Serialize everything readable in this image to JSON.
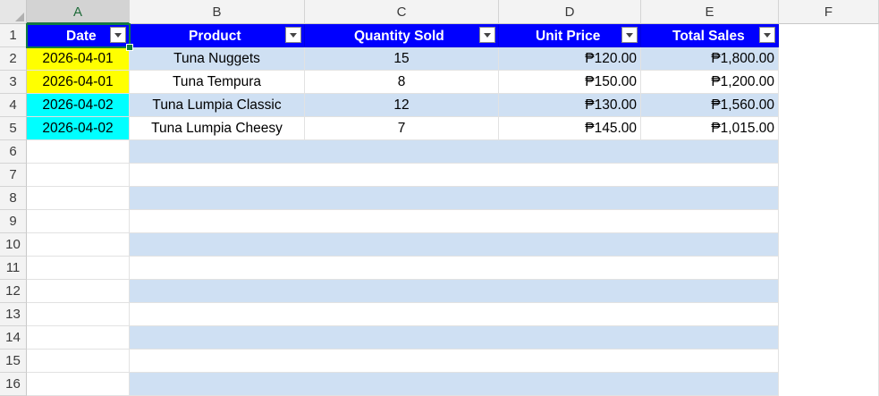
{
  "columns": [
    "A",
    "B",
    "C",
    "D",
    "E",
    "F"
  ],
  "rows": [
    "1",
    "2",
    "3",
    "4",
    "5",
    "6",
    "7",
    "8",
    "9",
    "10",
    "11",
    "12",
    "13",
    "14",
    "15",
    "16"
  ],
  "table": {
    "headers": [
      "Date",
      "Product",
      "Quantity Sold",
      "Unit Price",
      "Total Sales"
    ],
    "rows": [
      {
        "date": "2026-04-01",
        "product": "Tuna Nuggets",
        "qty": "15",
        "unit_price": "₱120.00",
        "total": "₱1,800.00"
      },
      {
        "date": "2026-04-01",
        "product": "Tuna Tempura",
        "qty": "8",
        "unit_price": "₱150.00",
        "total": "₱1,200.00"
      },
      {
        "date": "2026-04-02",
        "product": "Tuna Lumpia Classic",
        "qty": "12",
        "unit_price": "₱130.00",
        "total": "₱1,560.00"
      },
      {
        "date": "2026-04-02",
        "product": "Tuna Lumpia Cheesy",
        "qty": "7",
        "unit_price": "₱145.00",
        "total": "₱1,015.00"
      }
    ]
  },
  "colors": {
    "header_fill": "#0000ff",
    "date_highlight_1": "#ffff00",
    "date_highlight_2": "#00ffff",
    "band_fill": "#cfe0f3"
  },
  "selected_cell": "A1"
}
